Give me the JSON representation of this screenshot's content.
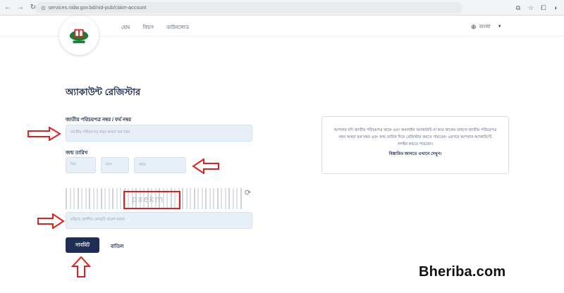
{
  "browser": {
    "url": "services.nidw.gov.bd/nid-pub/claim-account"
  },
  "header": {
    "nav": [
      "হোম",
      "ফিচস",
      "ডাউনলোড"
    ],
    "language": "বাংলা"
  },
  "form": {
    "title": "অ্যাকাউন্ট রেজিস্টার",
    "nid_label": "জাতীয় পরিচয়পত্র নম্বর / ফর্ম নম্বর",
    "nid_placeholder": "জাতীয় পরিচয়পত্র নম্বর অথবা ফর্ম নম্বর",
    "dob_label": "জন্ম তারিখ",
    "day_placeholder": "দিন",
    "month_placeholder": "মাস",
    "year_placeholder": "বছর",
    "captcha_text": "pxekm",
    "captcha_placeholder": "ছবিতে প্রদর্শিত কোডটি প্রবেশ করান",
    "submit": "সাবমিট",
    "cancel": "বাতিল"
  },
  "info": {
    "text": "আপনার যদি জাতীয় পরিচয়পত্র থাকে এবং অনলাইন অ্যাকাউন্ট না করে থাকেন তাহলে জাতীয় পরিচয়পত্র নম্বর অথবা ফর্ম নম্বর এবং জন্ম তারিখ দিয়ে রেজিস্টার করতে পারবেন। এরপরে আপনার অ্যাকাউন্টে লগইন করতে পারবেন।",
    "link": "বিস্তারিত জানতে এখানে দেখুন।"
  },
  "watermark": "Bheriba.com",
  "colors": {
    "primary": "#1e2e54",
    "field_bg": "#e7eff8",
    "annotation_red": "#e02020"
  }
}
